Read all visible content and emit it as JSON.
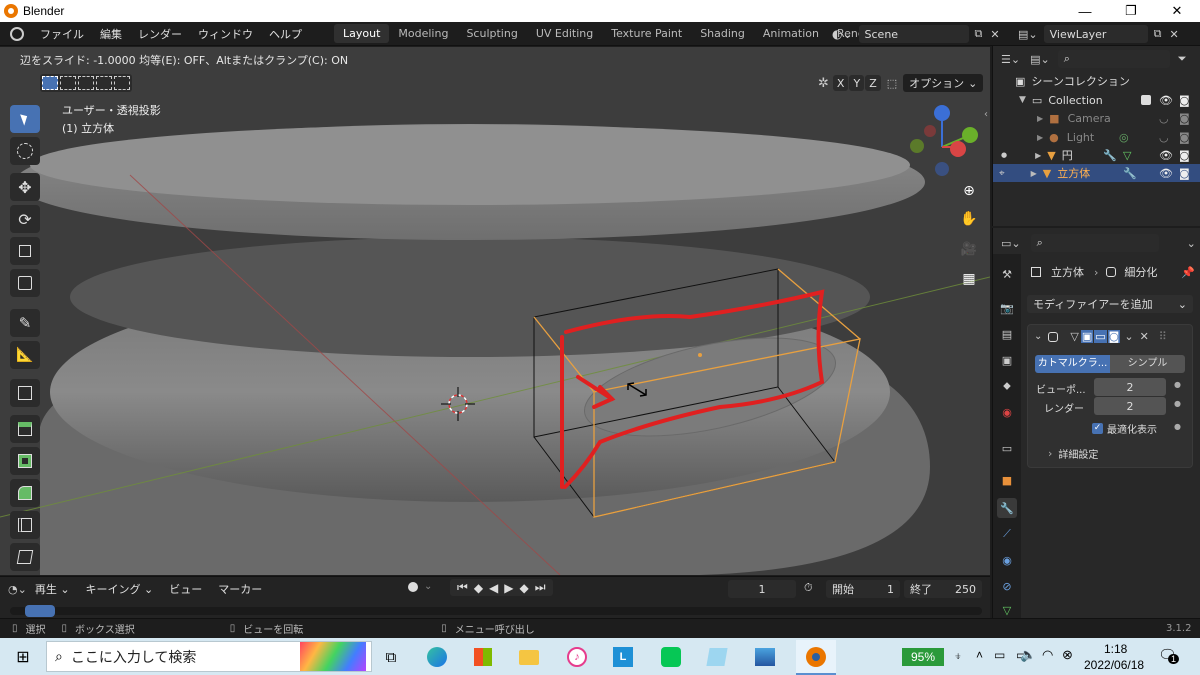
{
  "window": {
    "title": "Blender",
    "min": "—",
    "max": "❐",
    "close": "✕"
  },
  "menu": [
    "ファイル",
    "編集",
    "レンダー",
    "ウィンドウ",
    "ヘルプ"
  ],
  "workspaces": [
    "Layout",
    "Modeling",
    "Sculpting",
    "UV Editing",
    "Texture Paint",
    "Shading",
    "Animation",
    "Rendering"
  ],
  "scene": {
    "name": "Scene",
    "viewlayer": "ViewLayer"
  },
  "operator": {
    "text": "辺をスライド: -1.0000 均等(E): OFF、Altまたはクランプ(C): ON"
  },
  "viewport": {
    "projection": "ユーザー・透視投影",
    "object": "(1) 立方体",
    "axes": {
      "x": "X",
      "y": "Y",
      "z": "Z"
    },
    "options": "オプション"
  },
  "timeline": {
    "menus": [
      "再生",
      "キーイング",
      "ビュー",
      "マーカー"
    ],
    "current_frame": "1",
    "start_label": "開始",
    "start": "1",
    "end_label": "終了",
    "end": "250"
  },
  "status": {
    "select": "選択",
    "box_select": "ボックス選択",
    "rotate_view": "ビューを回転",
    "menu": "メニュー呼び出し",
    "version": "3.1.2"
  },
  "outliner": {
    "root": "シーンコレクション",
    "items": [
      {
        "name": "Collection"
      },
      {
        "name": "Camera"
      },
      {
        "name": "Light"
      },
      {
        "name": "円"
      },
      {
        "name": "立方体"
      }
    ]
  },
  "properties": {
    "breadcrumb_object": "立方体",
    "breadcrumb_modifier": "細分化",
    "add_modifier": "モディファイアーを追加",
    "modes": [
      "カトマルクラ...",
      "シンプル"
    ],
    "viewport_label": "ビューポ...",
    "viewport_value": "2",
    "render_label": "レンダー",
    "render_value": "2",
    "optimal_display": "最適化表示",
    "advanced": "詳細設定"
  },
  "taskbar": {
    "search": "ここに入力して検索",
    "battery": "95%",
    "time": "1:18",
    "date": "2022/06/18",
    "notifications": "1"
  },
  "colors": {
    "accent": "#4772b3",
    "selected_object": "#e8a040",
    "annotation": "#e02020",
    "taskbar": "#d6e8f2"
  }
}
